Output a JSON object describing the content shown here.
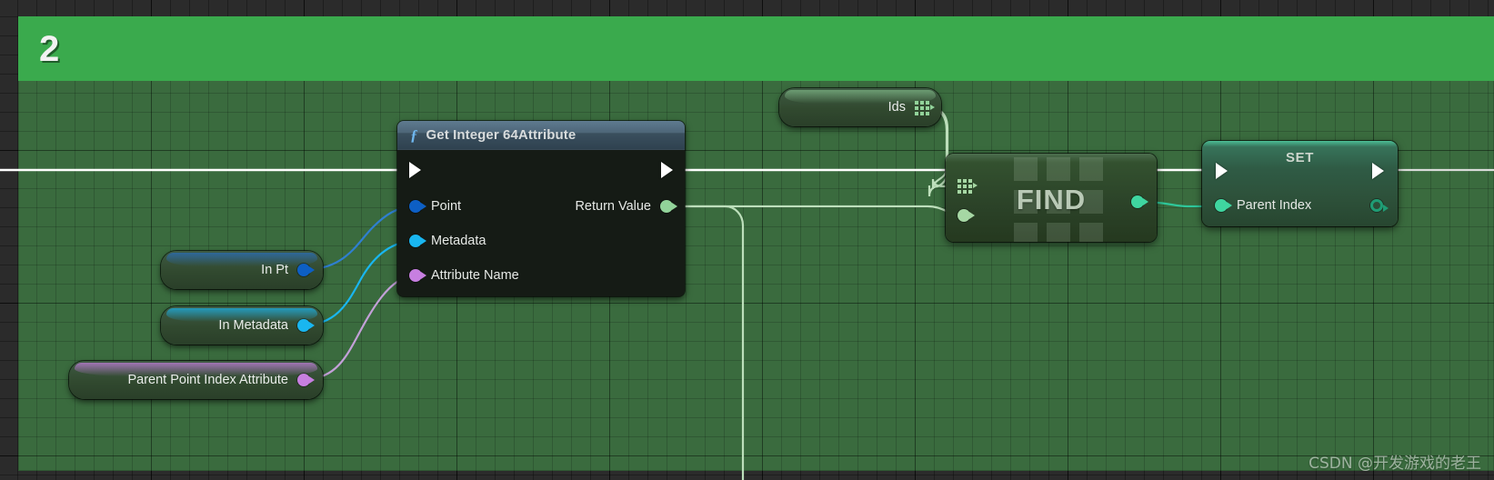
{
  "comment": {
    "title": "2",
    "color": "#3aaa4d"
  },
  "nodes": {
    "function": {
      "title": "Get Integer 64Attribute",
      "icon": "function-f-icon",
      "exec_in": "exec-in-pin",
      "exec_out": "exec-out-pin",
      "inputs": [
        {
          "label": "Point",
          "color": "#0d5fc4",
          "type": "object"
        },
        {
          "label": "Metadata",
          "color": "#19b6f0",
          "type": "object"
        },
        {
          "label": "Attribute Name",
          "color": "#c77fe0",
          "type": "name"
        }
      ],
      "outputs": [
        {
          "label": "Return Value",
          "color": "#92d39a",
          "type": "int64"
        }
      ]
    },
    "variables": [
      {
        "label": "In Pt",
        "color": "#0d5fc4"
      },
      {
        "label": "In Metadata",
        "color": "#19b6f0"
      },
      {
        "label": "Parent Point Index Attribute",
        "color": "#c77fe0"
      }
    ],
    "ids": {
      "label": "Ids",
      "color": "#92d39a",
      "pin_type": "array-grid-pin"
    },
    "find": {
      "label": "FIND",
      "input_array_color": "#a6d7a4",
      "input_value_color": "#a6d7a4",
      "output_color": "#3fd6a0"
    },
    "set": {
      "title": "SET",
      "input_label": "Parent Index",
      "input_color": "#3fd6a0",
      "output_color": "#1f9c74"
    }
  },
  "watermark": {
    "text": "CSDN @开发游戏的老王"
  }
}
